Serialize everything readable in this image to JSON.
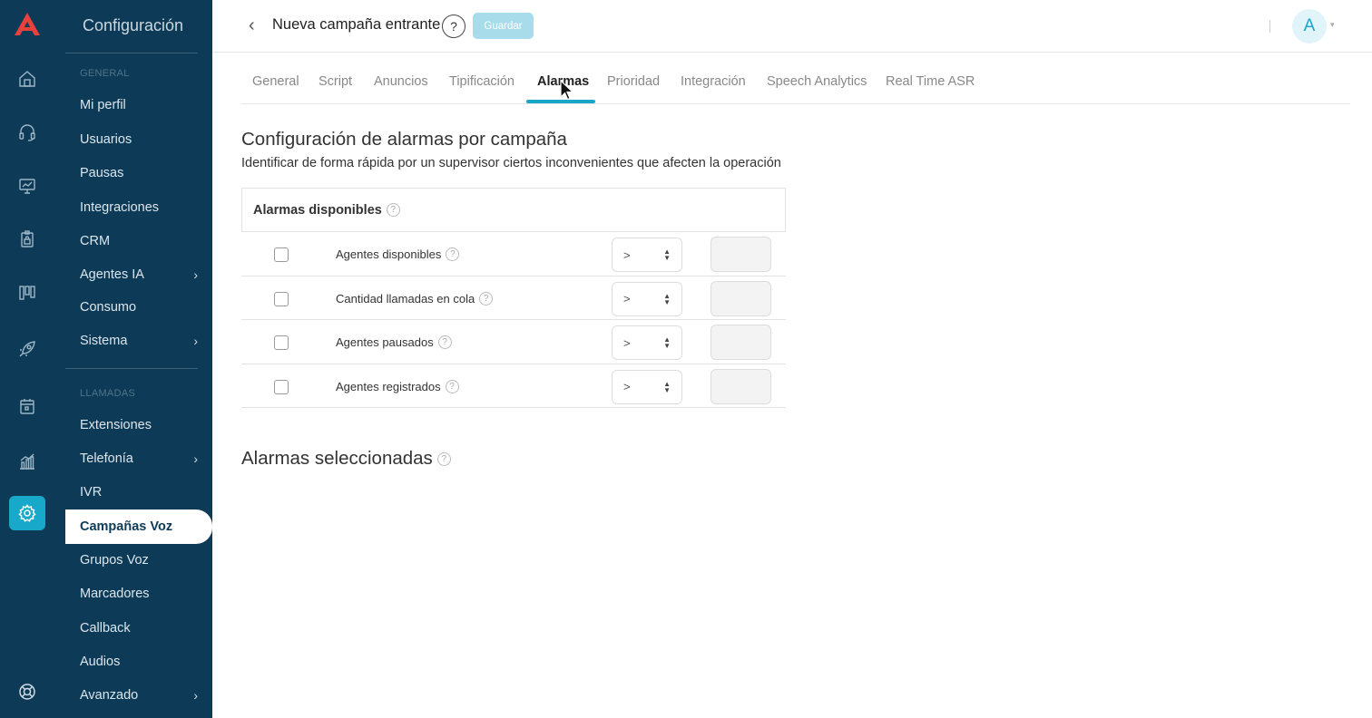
{
  "colors": {
    "sidebar": "#0d3b57",
    "accent": "#1aa6c8",
    "save_button": "#a9dcea",
    "logo": "#e8413c"
  },
  "rail": {
    "logo": "logo-icon",
    "icons": [
      "home-icon",
      "headset-icon",
      "monitor-icon",
      "badge-icon",
      "kanban-icon",
      "rocket-icon",
      "calendar-icon",
      "analytics-icon",
      "settings-icon",
      "help-lifebuoy-icon"
    ],
    "active": "settings-icon"
  },
  "menu": {
    "title": "Configuración",
    "sections": {
      "general": "GENERAL",
      "llamadas": "LLAMADAS"
    },
    "general_items": [
      {
        "label": "Mi perfil"
      },
      {
        "label": "Usuarios"
      },
      {
        "label": "Pausas"
      },
      {
        "label": "Integraciones"
      },
      {
        "label": "CRM"
      },
      {
        "label": "Agentes IA",
        "chevron": "›"
      },
      {
        "label": "Consumo"
      },
      {
        "label": "Sistema",
        "chevron": "›"
      }
    ],
    "llamadas_items": [
      {
        "label": "Extensiones"
      },
      {
        "label": "Telefonía",
        "chevron": "›"
      },
      {
        "label": "IVR"
      },
      {
        "label": "Campañas Voz",
        "active": true
      },
      {
        "label": "Grupos Voz"
      },
      {
        "label": "Marcadores"
      },
      {
        "label": "Callback"
      },
      {
        "label": "Audios"
      },
      {
        "label": "Avanzado",
        "chevron": "›"
      }
    ]
  },
  "header": {
    "back": "‹",
    "title": "Nueva campaña entrante",
    "help": "?",
    "save_label": "Guardar",
    "avatar": "A",
    "avatar_caret": "▾"
  },
  "tabs": [
    "General",
    "Script",
    "Anuncios",
    "Tipificación",
    "Alarmas",
    "Prioridad",
    "Integración",
    "Speech Analytics",
    "Real Time ASR"
  ],
  "active_tab": "Alarmas",
  "content": {
    "title": "Configuración de alarmas por campaña",
    "subtitle": "Identificar de forma rápida por un supervisor ciertos inconvenientes que afecten la operación",
    "available_title": "Alarmas disponibles",
    "help_glyph": "?",
    "alarms": [
      {
        "label": "Agentes disponibles",
        "operator": ">",
        "value": ""
      },
      {
        "label": "Cantidad llamadas en cola",
        "operator": ">",
        "value": ""
      },
      {
        "label": "Agentes pausados",
        "operator": ">",
        "value": ""
      },
      {
        "label": "Agentes registrados",
        "operator": ">",
        "value": ""
      }
    ],
    "selected_title": "Alarmas seleccionadas"
  }
}
